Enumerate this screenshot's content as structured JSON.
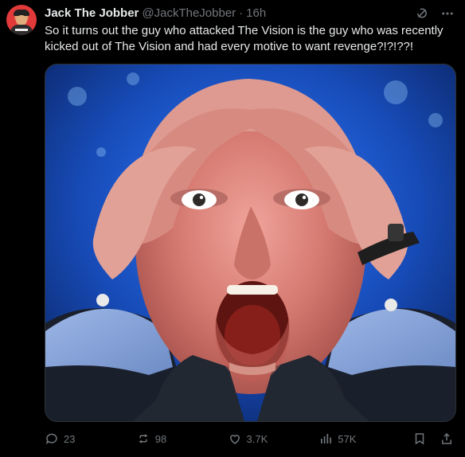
{
  "post": {
    "author_name": "Jack The Jobber",
    "author_handle": "@JackTheJobber",
    "separator": "·",
    "time": "16h",
    "text": "So it turns out the guy who attacked The Vision is the guy who was recently kicked out of The Vision and had every motive to want revenge?!?!??!"
  },
  "icons": {
    "grok": "grok-icon",
    "more": "more-icon",
    "reply": "reply-icon",
    "repost": "repost-icon",
    "like": "like-icon",
    "views": "views-icon",
    "bookmark": "bookmark-icon",
    "share": "share-icon"
  },
  "stats": {
    "replies": "23",
    "reposts": "98",
    "likes": "3.7K",
    "views": "57K"
  },
  "colors": {
    "background": "#000000",
    "text": "#e7e9ea",
    "muted": "#71767b",
    "border": "#2f3336"
  }
}
